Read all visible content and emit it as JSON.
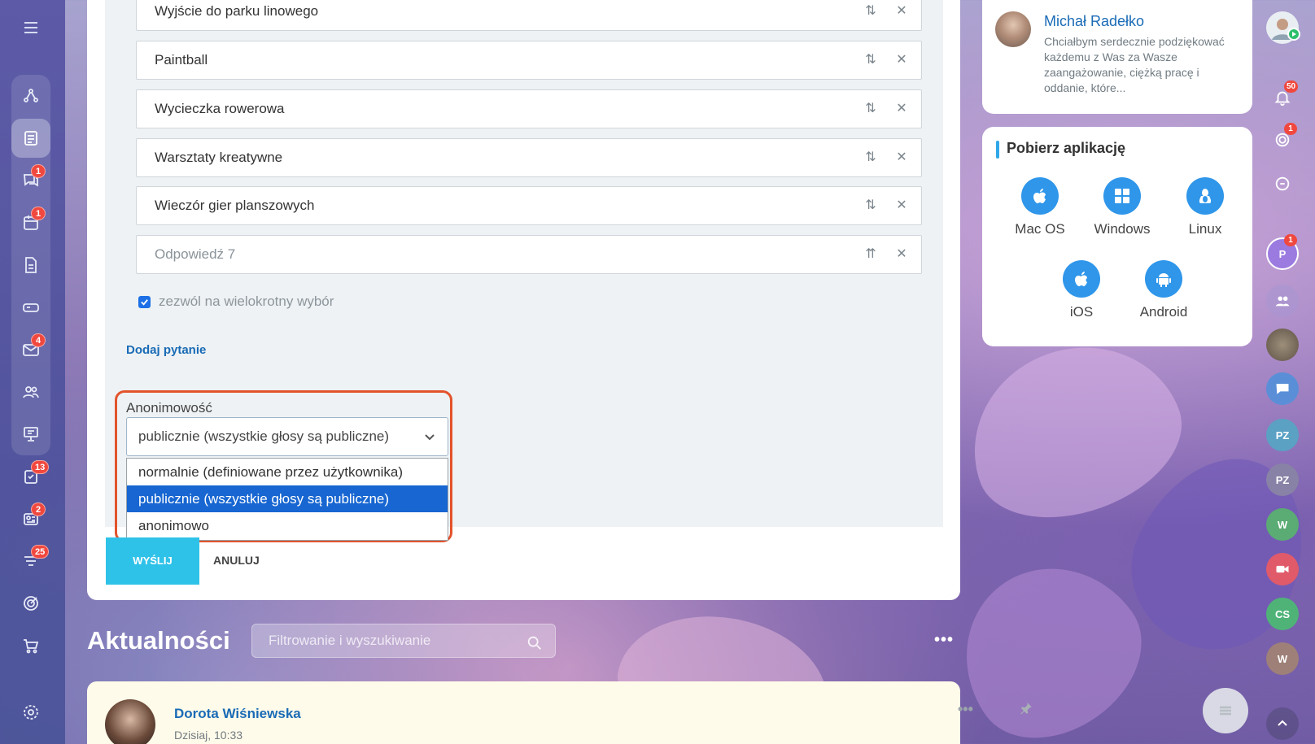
{
  "poll": {
    "answers": [
      {
        "text": "Wyjście do parku linowego"
      },
      {
        "text": "Paintball"
      },
      {
        "text": "Wycieczka rowerowa"
      },
      {
        "text": "Warsztaty kreatywne"
      },
      {
        "text": "Wieczór gier planszowych"
      }
    ],
    "answer_placeholder": "Odpowiedź 7",
    "multiple_choice_label": "zezwól na wielokrotny wybór",
    "multiple_choice_checked": true,
    "add_question_label": "Dodaj pytanie",
    "anonymity": {
      "label": "Anonimowość",
      "selected": "publicznie (wszystkie głosy są publiczne)",
      "options": [
        "normalnie (definiowane przez użytkownika)",
        "publicznie (wszystkie głosy są publiczne)",
        "anonimowo"
      ],
      "selected_index": 1
    },
    "send_label": "WYŚLIJ",
    "cancel_label": "ANULUJ"
  },
  "feed": {
    "title": "Aktualności",
    "search_placeholder": "Filtrowanie i wyszukiwanie",
    "more_label": "•••",
    "post": {
      "author": "Dorota Wiśniewska",
      "time": "Dzisiaj, 10:33",
      "more_label": "•••"
    }
  },
  "user_card": {
    "name": "Michał Radełko",
    "text": "Chciałbym serdecznie podziękować każdemu z Was za Wasze zaangażowanie, ciężką pracę i oddanie, które..."
  },
  "apps": {
    "title": "Pobierz aplikację",
    "items": [
      {
        "label": "Mac OS",
        "icon": "apple-icon"
      },
      {
        "label": "Windows",
        "icon": "windows-icon"
      },
      {
        "label": "Linux",
        "icon": "linux-icon"
      },
      {
        "label": "iOS",
        "icon": "apple-icon"
      },
      {
        "label": "Android",
        "icon": "android-icon"
      }
    ]
  },
  "left_rail": {
    "badges": {
      "chat": "1",
      "calendar": "1",
      "mail": "4",
      "tasks": "13",
      "feed": "2",
      "filters": "25"
    }
  },
  "right_rail": {
    "notifications_badge": "50",
    "goals_badge": "1",
    "p_badge": "1",
    "avatars": [
      "P",
      "PZ",
      "PZ",
      "W",
      "CS",
      "W"
    ]
  },
  "colors": {
    "accent": "#1a6bb6",
    "send_button": "#2fc2e8",
    "highlight_frame": "#e3532b",
    "selected_option": "#1766d1",
    "badge": "#f0483e"
  }
}
